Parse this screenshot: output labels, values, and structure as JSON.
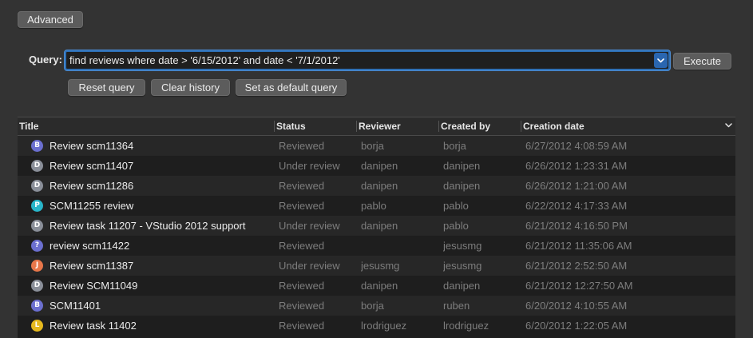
{
  "toolbar": {
    "advanced_label": "Advanced"
  },
  "query": {
    "label": "Query:",
    "value": "find reviews where date > '6/15/2012' and date < '7/1/2012'",
    "execute_label": "Execute",
    "reset_label": "Reset query",
    "clear_label": "Clear history",
    "default_label": "Set as default query"
  },
  "table": {
    "columns": [
      "Title",
      "Status",
      "Reviewer",
      "Created by",
      "Creation date"
    ],
    "rows": [
      {
        "avatar": "B",
        "avatar_color": "#6b6fcf",
        "title": "Review scm11364",
        "status": "Reviewed",
        "reviewer": "borja",
        "created_by": "borja",
        "date": "6/27/2012 4:08:59 AM"
      },
      {
        "avatar": "D",
        "avatar_color": "#8a8f99",
        "title": "Review scm11407",
        "status": "Under review",
        "reviewer": "danipen",
        "created_by": "danipen",
        "date": "6/26/2012 1:23:31 AM"
      },
      {
        "avatar": "D",
        "avatar_color": "#8a8f99",
        "title": "Review scm11286",
        "status": "Reviewed",
        "reviewer": "danipen",
        "created_by": "danipen",
        "date": "6/26/2012 1:21:00 AM"
      },
      {
        "avatar": "P",
        "avatar_color": "#29b5c9",
        "title": "SCM11255 review",
        "status": "Reviewed",
        "reviewer": "pablo",
        "created_by": "pablo",
        "date": "6/22/2012 4:17:33 AM"
      },
      {
        "avatar": "D",
        "avatar_color": "#8a8f99",
        "title": "Review task 11207 - VStudio 2012 support",
        "status": "Under review",
        "reviewer": "danipen",
        "created_by": "pablo",
        "date": "6/21/2012 4:16:50 PM"
      },
      {
        "avatar": "?",
        "avatar_color": "#6b6fcf",
        "title": "review scm11422",
        "status": "Reviewed",
        "reviewer": "",
        "created_by": "jesusmg",
        "date": "6/21/2012 11:35:06 AM"
      },
      {
        "avatar": "J",
        "avatar_color": "#e8774a",
        "title": "Review scm11387",
        "status": "Under review",
        "reviewer": "jesusmg",
        "created_by": "jesusmg",
        "date": "6/21/2012 2:52:50 AM"
      },
      {
        "avatar": "D",
        "avatar_color": "#8a8f99",
        "title": "Review SCM11049",
        "status": "Reviewed",
        "reviewer": "danipen",
        "created_by": "danipen",
        "date": "6/21/2012 12:27:50 AM"
      },
      {
        "avatar": "B",
        "avatar_color": "#6b6fcf",
        "title": "SCM11401",
        "status": "Reviewed",
        "reviewer": "borja",
        "created_by": "ruben",
        "date": "6/20/2012 4:10:55 AM"
      },
      {
        "avatar": "L",
        "avatar_color": "#e6b91e",
        "title": "Review task 11402",
        "status": "Reviewed",
        "reviewer": "lrodriguez",
        "created_by": "lrodriguez",
        "date": "6/20/2012 1:22:05 AM"
      }
    ]
  },
  "icons": {
    "dropdown": "chevron-down-icon",
    "sort": "chevron-down-icon"
  }
}
